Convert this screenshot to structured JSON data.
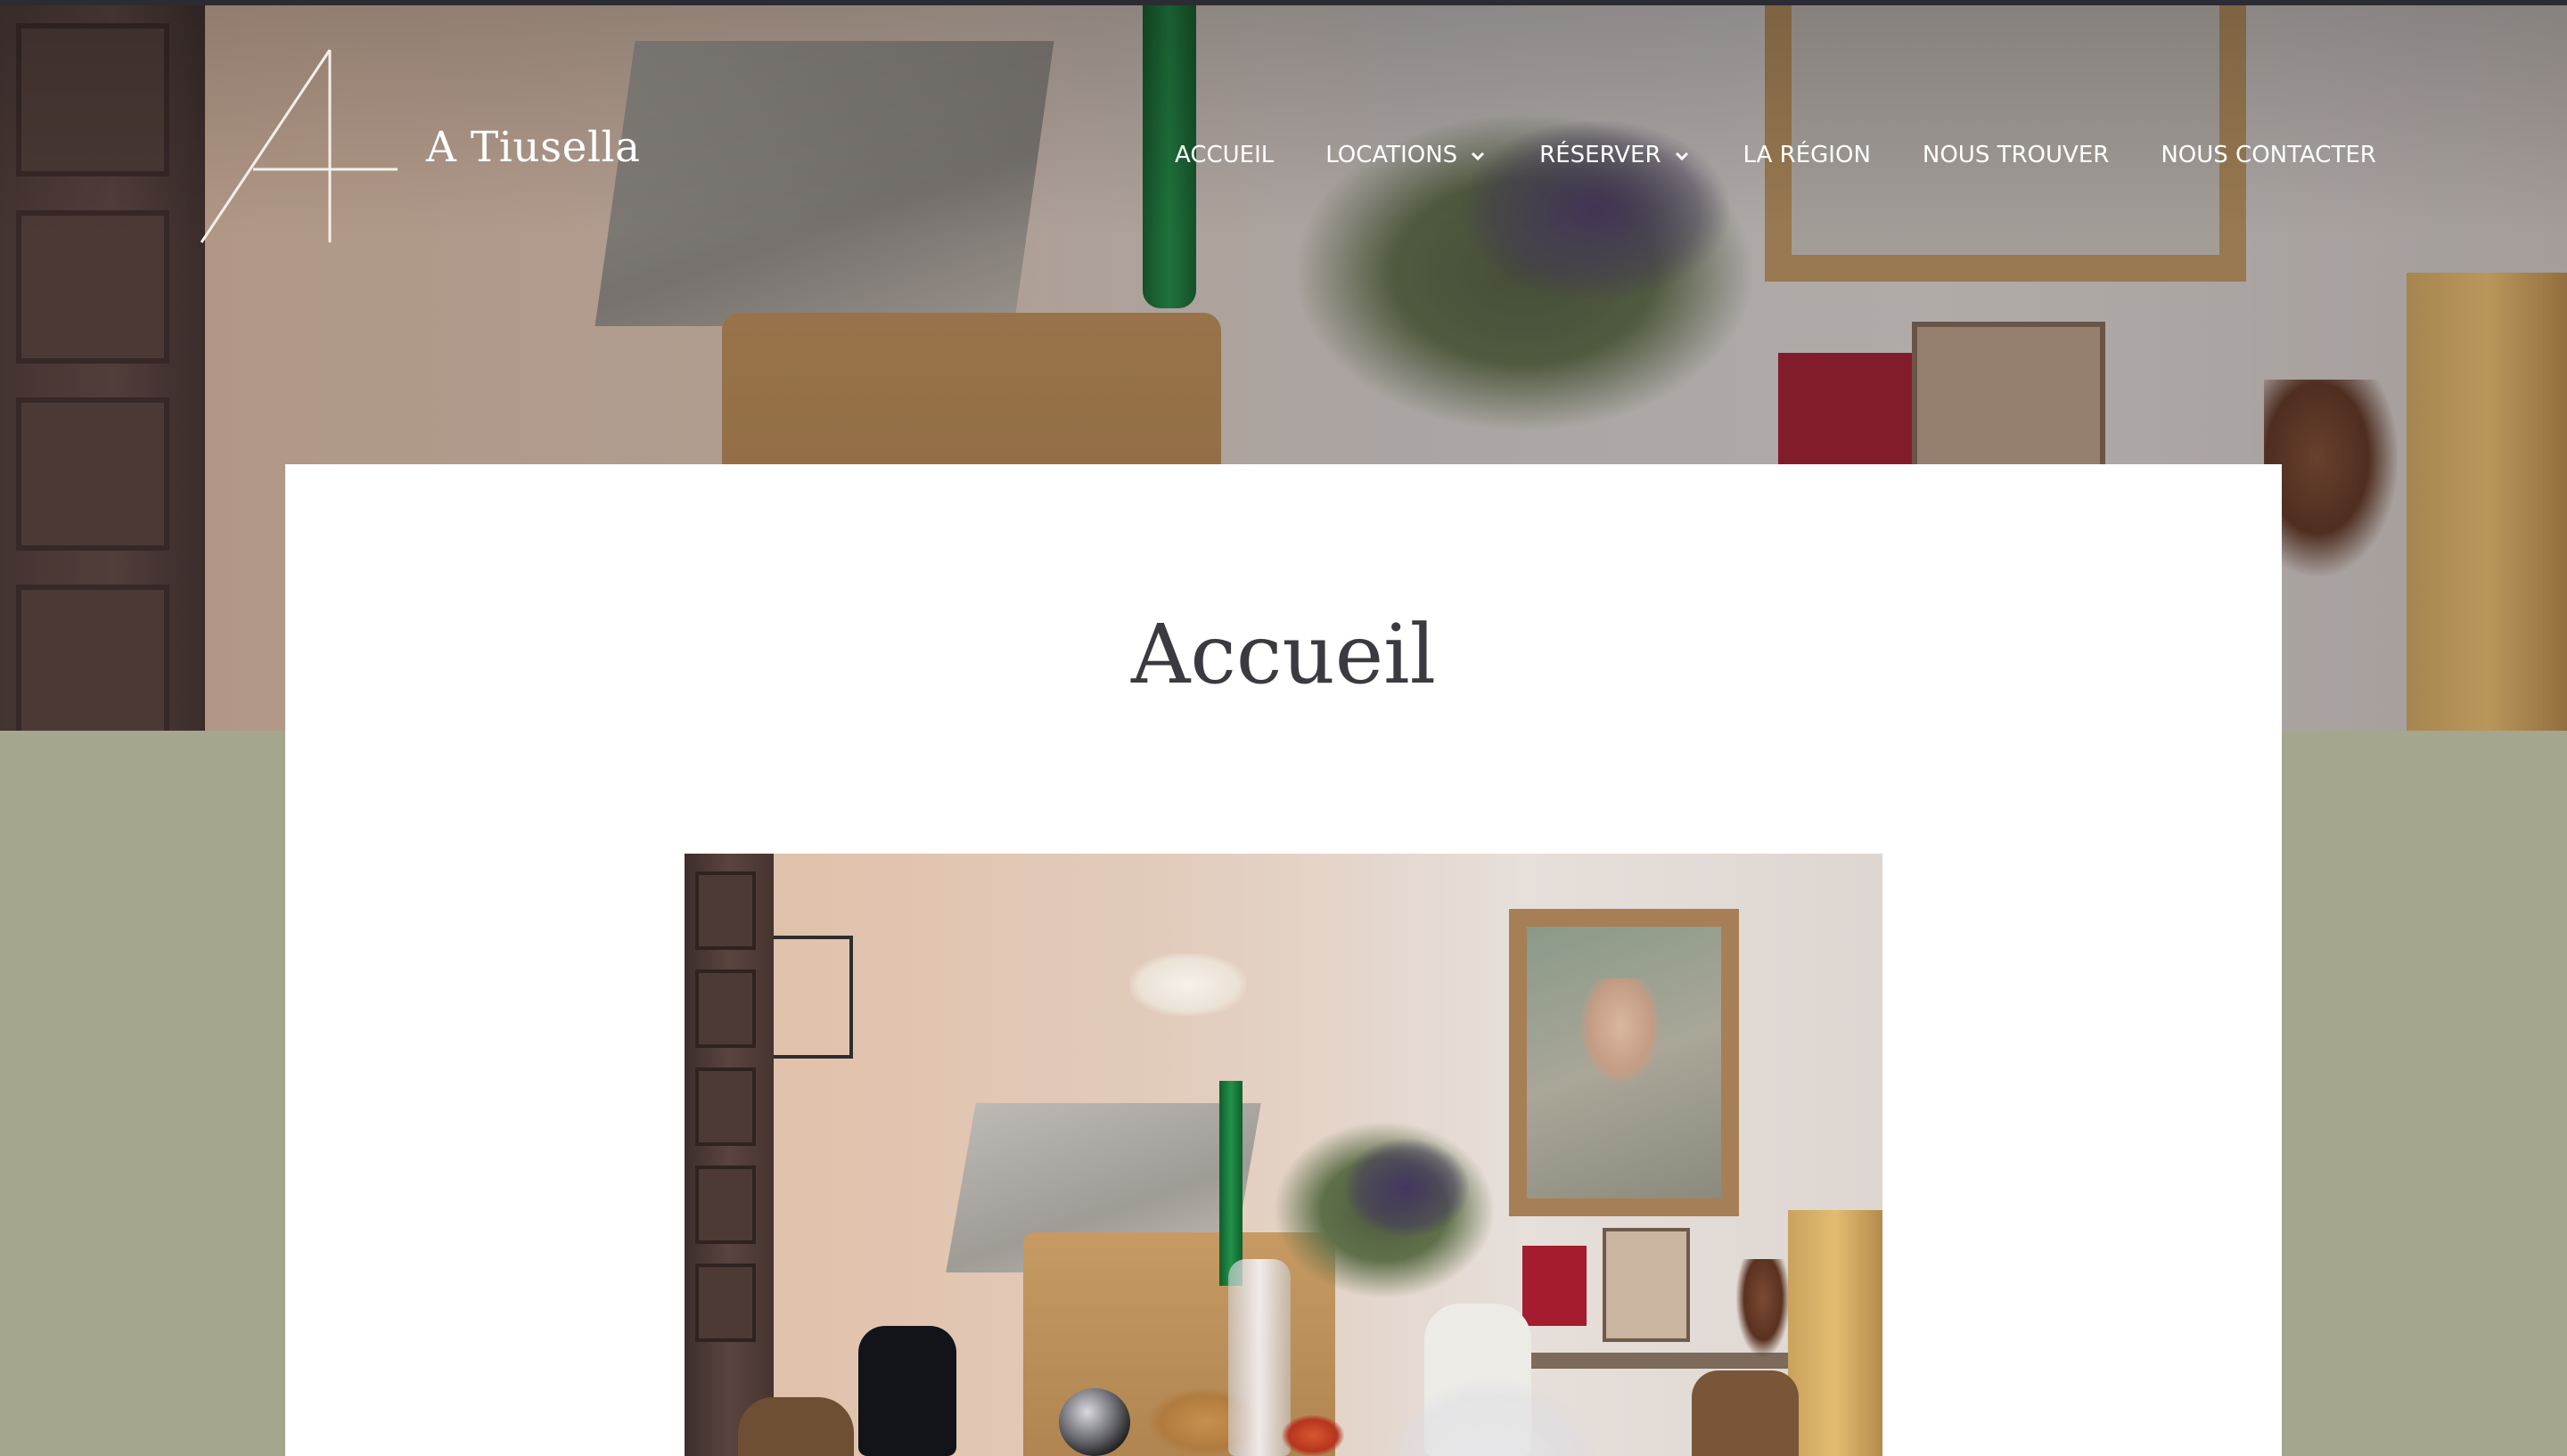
{
  "site": {
    "title": "A Tiusella",
    "logo_icon": "a-monogram-logo"
  },
  "nav": {
    "items": [
      {
        "label": "ACCUEIL",
        "has_dropdown": false
      },
      {
        "label": "LOCATIONS",
        "has_dropdown": true
      },
      {
        "label": "RÉSERVER",
        "has_dropdown": true
      },
      {
        "label": "LA RÉGION",
        "has_dropdown": false
      },
      {
        "label": "NOUS TROUVER",
        "has_dropdown": false
      },
      {
        "label": "NOUS CONTACTER",
        "has_dropdown": false
      }
    ]
  },
  "main": {
    "page_title": "Accueil"
  },
  "colors": {
    "page_background": "#a4a68e",
    "card_background": "#ffffff",
    "title_text": "#3a3a40",
    "nav_text": "#ffffff"
  }
}
